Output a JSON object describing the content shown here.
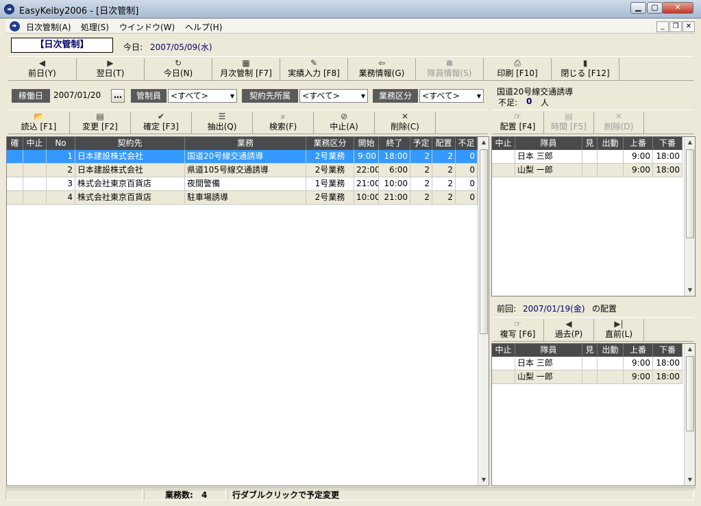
{
  "window": {
    "title": "EasyKeiby2006 - [日次管制]"
  },
  "menu": {
    "items": [
      "日次管制(A)",
      "処理(S)",
      "ウインドウ(W)",
      "ヘルプ(H)"
    ]
  },
  "header": {
    "mode": "【日次管制】",
    "today_label": "今日:",
    "today_value": "2007/05/09(水)"
  },
  "toolbar": {
    "buttons": [
      {
        "icon": "◀",
        "label": "前日(Y)",
        "enabled": true
      },
      {
        "icon": "▶",
        "label": "翌日(T)",
        "enabled": true
      },
      {
        "icon": "↻",
        "label": "今日(N)",
        "enabled": true
      },
      {
        "icon": "▦",
        "label": "月次管制 [F7]",
        "enabled": true
      },
      {
        "icon": "✎",
        "label": "実績入力 [F8]",
        "enabled": true
      },
      {
        "icon": "⇦",
        "label": "業務情報(G)",
        "enabled": true
      },
      {
        "icon": "☗",
        "label": "隊員情報(S)",
        "enabled": false
      },
      {
        "icon": "⎙",
        "label": "印刷 [F10]",
        "enabled": true
      },
      {
        "icon": "▮",
        "label": "閉じる [F12]",
        "enabled": true
      }
    ]
  },
  "filters": {
    "date_label": "稼働日",
    "date_value": "2007/01/20",
    "date_btn": "…",
    "manager_label": "管制員",
    "manager_value": "<すべて>",
    "client_label": "契約先所属",
    "client_value": "<すべて>",
    "kind_label": "業務区分",
    "kind_value": "<すべて>"
  },
  "selected_info": {
    "task": "国道20号線交通誘導",
    "short_label": "不足:",
    "short_value": "0",
    "short_unit": "人"
  },
  "task_toolbar": {
    "buttons": [
      {
        "icon": "📂",
        "label": "読込 [F1]",
        "enabled": true
      },
      {
        "icon": "▤",
        "label": "変更 [F2]",
        "enabled": true
      },
      {
        "icon": "✔",
        "label": "確定 [F3]",
        "enabled": true
      },
      {
        "icon": "☰",
        "label": "抽出(Q)",
        "enabled": true
      },
      {
        "icon": "⌕",
        "label": "検索(F)",
        "enabled": true
      },
      {
        "icon": "⊘",
        "label": "中止(A)",
        "enabled": true
      },
      {
        "icon": "✕",
        "label": "削除(C)",
        "enabled": true
      }
    ]
  },
  "assign_toolbar": {
    "buttons": [
      {
        "icon": "☞",
        "label": "配置 [F4]",
        "enabled": true
      },
      {
        "icon": "▤",
        "label": "時間 [F5]",
        "enabled": false
      },
      {
        "icon": "✕",
        "label": "削除(D)",
        "enabled": false
      }
    ]
  },
  "task_table": {
    "headers": [
      "確",
      "中止",
      "No",
      "契約先",
      "業務",
      "業務区分",
      "開始",
      "終了",
      "予定",
      "配置",
      "不足"
    ],
    "rows": [
      [
        "",
        "",
        "1",
        "日本建設株式会社",
        "国道20号線交通誘導",
        "2号業務",
        "9:00",
        "18:00",
        "2",
        "2",
        "0"
      ],
      [
        "",
        "",
        "2",
        "日本建設株式会社",
        "県道105号線交通誘導",
        "2号業務",
        "22:00",
        "6:00",
        "2",
        "2",
        "0"
      ],
      [
        "",
        "",
        "3",
        "株式会社東京百貨店",
        "夜間警備",
        "1号業務",
        "21:00",
        "10:00",
        "2",
        "2",
        "0"
      ],
      [
        "",
        "",
        "4",
        "株式会社東京百貨店",
        "駐車場誘導",
        "2号業務",
        "10:00",
        "21:00",
        "2",
        "2",
        "0"
      ]
    ]
  },
  "assign_table": {
    "headers": [
      "中止",
      "隊員",
      "見",
      "出動",
      "上番",
      "下番"
    ],
    "rows": [
      [
        "",
        "日本 三郎",
        "",
        "",
        "9:00",
        "18:00"
      ],
      [
        "",
        "山梨 一郎",
        "",
        "",
        "9:00",
        "18:00"
      ]
    ]
  },
  "previous": {
    "label": "前回:",
    "date": "2007/01/19(金)",
    "suffix": "の配置"
  },
  "prev_toolbar": {
    "buttons": [
      {
        "icon": "☞",
        "label": "複写 [F6]",
        "enabled": true
      },
      {
        "icon": "◀",
        "label": "過去(P)",
        "enabled": true
      },
      {
        "icon": "▶|",
        "label": "直前(L)",
        "enabled": true
      }
    ]
  },
  "prev_table": {
    "headers": [
      "中止",
      "隊員",
      "見",
      "出動",
      "上番",
      "下番"
    ],
    "rows": [
      [
        "",
        "日本 三郎",
        "",
        "",
        "9:00",
        "18:00"
      ],
      [
        "",
        "山梨 一郎",
        "",
        "",
        "9:00",
        "18:00"
      ]
    ]
  },
  "status": {
    "count_label": "業務数:",
    "count_value": "4",
    "hint": "行ダブルクリックで予定変更"
  },
  "colors": {
    "selected_row": "#3399ff",
    "alt_row": "#ece9d8",
    "header_bg": "#4a4a4a"
  }
}
